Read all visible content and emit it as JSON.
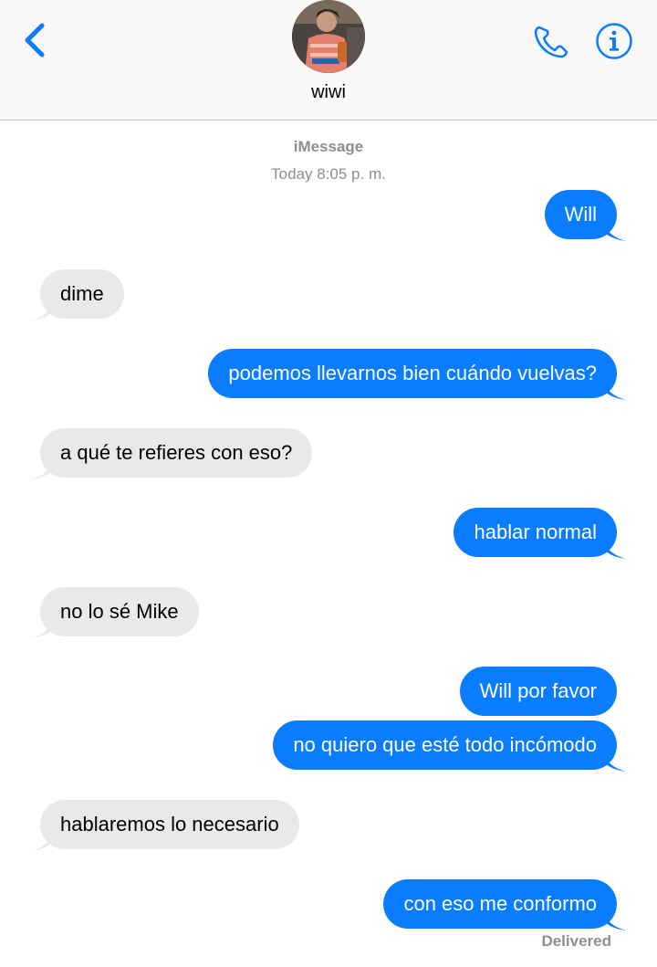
{
  "header": {
    "contact_name": "wiwi",
    "avatar": "contact-photo",
    "icons": {
      "back": "chevron-left-icon",
      "phone": "phone-icon",
      "info": "info-icon"
    }
  },
  "thread": {
    "service": "iMessage",
    "timestamp": "Today 8:05 p. m.",
    "messages": [
      {
        "from": "me",
        "text": "Will"
      },
      {
        "from": "them",
        "text": "dime"
      },
      {
        "from": "me",
        "text": "podemos llevarnos bien cuándo vuelvas?"
      },
      {
        "from": "them",
        "text": "a qué te refieres con eso?"
      },
      {
        "from": "me",
        "text": "hablar normal"
      },
      {
        "from": "them",
        "text": "no lo sé Mike"
      },
      {
        "from": "me",
        "text": "Will por favor"
      },
      {
        "from": "me",
        "text": "no quiero que esté todo incómodo"
      },
      {
        "from": "them",
        "text": "hablaremos lo necesario"
      },
      {
        "from": "me",
        "text": "con eso me conformo"
      }
    ],
    "status": "Delivered"
  },
  "colors": {
    "accent": "#0a7cff",
    "incoming_bubble": "#e9e9eb",
    "secondary_text": "#8e8e93"
  }
}
